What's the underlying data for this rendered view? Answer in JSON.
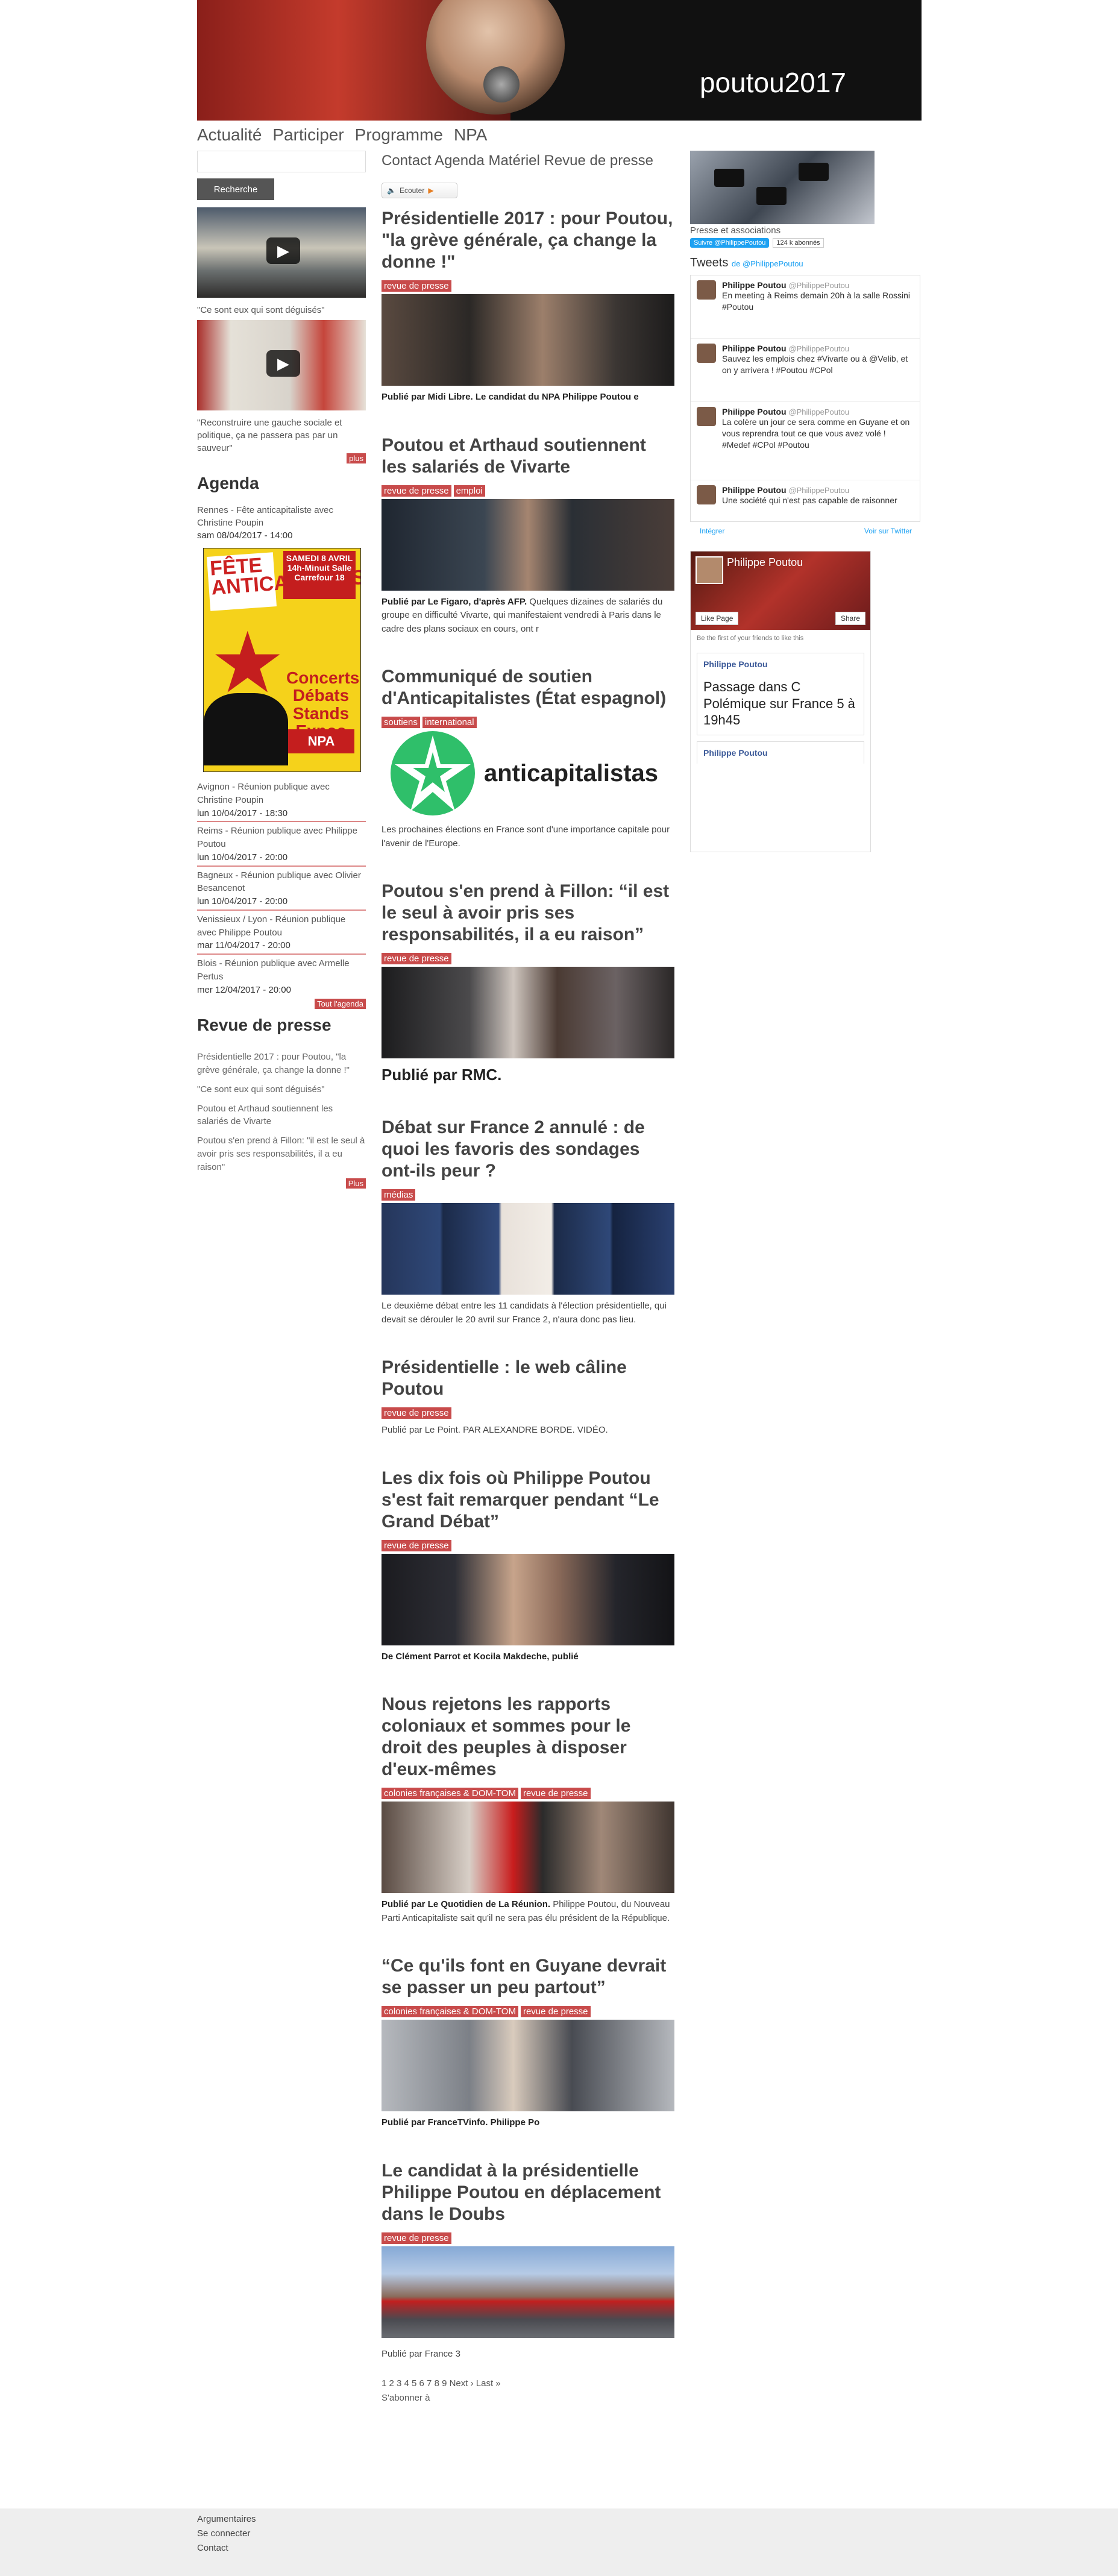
{
  "header": {
    "brand": "poutou2017"
  },
  "nav": [
    "Actualité",
    "Participer",
    "Programme",
    "NPA"
  ],
  "search": {
    "button": "Recherche"
  },
  "videos": [
    {
      "caption": "\"Ce sont eux qui sont déguisés\""
    },
    {
      "caption": "\"Reconstruire une gauche sociale et politique, ça ne passera pas par un sauveur\""
    }
  ],
  "more": "plus",
  "agenda": {
    "title": "Agenda",
    "first": {
      "label": "Rennes - Fête anticapitaliste avec Christine Poupin",
      "date": "sam 08/04/2017 - 14:00"
    },
    "poster": {
      "p1": "FÊTE ANTICAPITALISTE",
      "p2": "SAMEDI 8 AVRIL 14h-Minuit Salle Carrefour 18",
      "concert": "Concerts Débats Stands Expos",
      "npa": "NPA"
    },
    "items": [
      {
        "label": "Avignon - Réunion publique avec Christine Poupin",
        "date": "lun 10/04/2017 - 18:30"
      },
      {
        "label": "Reims - Réunion publique avec Philippe Poutou",
        "date": "lun 10/04/2017 - 20:00"
      },
      {
        "label": "Bagneux - Réunion publique avec Olivier Besancenot",
        "date": "lun 10/04/2017 - 20:00"
      },
      {
        "label": "Venissieux / Lyon - Réunion publique avec Philippe Poutou",
        "date": "mar 11/04/2017 - 20:00"
      },
      {
        "label": "Blois - Réunion publique avec Armelle Pertus",
        "date": "mer 12/04/2017 - 20:00"
      }
    ],
    "all": "Tout l'agenda"
  },
  "press": {
    "title": "Revue de presse",
    "items": [
      "Présidentielle 2017 : pour Poutou, \"la grève générale, ça change la donne !\"",
      "\"Ce sont eux qui sont déguisés\"",
      "Poutou et Arthaud soutiennent les salariés de Vivarte",
      "Poutou s'en prend à Fillon: \"il est le seul à avoir pris ses responsabilités, il a eu raison\""
    ],
    "more": "Plus"
  },
  "topmenu": "Contact Agenda Matériel Revue de presse",
  "listen": "Ecouter",
  "articles": [
    {
      "title": "Présidentielle 2017 : pour Poutou, \"la grève générale, ça change la donne !\"",
      "tags": [
        "revue de presse"
      ],
      "text_b": "Publié par Midi Libre. Le candidat du NPA Philippe Poutou e",
      "text": ""
    },
    {
      "title": "Poutou et Arthaud soutiennent les salariés de Vivarte",
      "tags": [
        "revue de presse",
        "emploi"
      ],
      "text_b": "Publié par Le Figaro, d'après AFP.",
      "text": " Quelques dizaines de salariés du groupe en difficulté Vivarte, qui manifestaient vendredi à Paris dans le cadre des plans sociaux en cours, ont r"
    },
    {
      "title": "Communiqué de soutien d'Anticapitalistes (État espagnol)",
      "tags": [
        "soutiens",
        "international"
      ],
      "logo": "anticapitalistas",
      "text_b": "",
      "text": "Les prochaines élections en France sont d'une importance capitale pour l'avenir de l'Europe."
    },
    {
      "title": "Poutou s'en prend à Fillon: “il est le seul à avoir pris ses responsabilités, il a eu raison”",
      "tags": [
        "revue de presse"
      ],
      "text_b": "Publié par RMC.",
      "text": ""
    },
    {
      "title": "Débat sur France 2 annulé : de quoi les favoris des sondages ont-ils peur ?",
      "tags": [
        "médias"
      ],
      "text_b": "",
      "text": "Le deuxième débat entre les 11 candidats à l'élection présidentielle, qui devait se dérouler le 20 avril sur France 2, n'aura donc pas lieu."
    },
    {
      "title": "Présidentielle : le web câline Poutou",
      "tags": [
        "revue de presse"
      ],
      "text_b": "",
      "text": "Publié par Le Point. PAR ALEXANDRE BORDE. VIDÉO."
    },
    {
      "title": "Les dix fois où Philippe Poutou s'est fait remarquer pendant “Le Grand Débat”",
      "tags": [
        "revue de presse"
      ],
      "text_b": "De Clément Parrot et Kocila Makdeche, publié",
      "text": ""
    },
    {
      "title": "Nous rejetons les rapports coloniaux et sommes pour le droit des peuples à disposer d'eux-mêmes",
      "tags": [
        "colonies françaises & DOM-TOM",
        "revue de presse"
      ],
      "text_b": "Publié par Le Quotidien de La Réunion.",
      "text": " Philippe Poutou, du Nouveau Parti Anticapitaliste sait qu'il ne sera pas élu président de la République."
    },
    {
      "title": "“Ce qu'ils font en Guyane devrait se passer un peu partout”",
      "tags": [
        "colonies françaises & DOM-TOM",
        "revue de presse"
      ],
      "text_b": "Publié par FranceTVinfo. Philippe Po",
      "text": ""
    },
    {
      "title": "Le candidat à la présidentielle Philippe Poutou en déplacement dans le Doubs",
      "tags": [
        "revue de presse"
      ],
      "text_b": "",
      "text": "Publié par France 3"
    }
  ],
  "pager": {
    "pages": "1 2 3 4 5 6 7 8 9 Next › Last »",
    "subscribe": "S'abonner à"
  },
  "right": {
    "presse_label": "Presse et associations",
    "follow": "Suivre @PhilippePoutou",
    "followers": "124 k abonnés",
    "tweets_title": "Tweets",
    "tweets_by": "de @PhilippePoutou",
    "tweets": [
      {
        "name": "Philippe Poutou",
        "handle": "@PhilippePoutou",
        "text": "En meeting à Reims demain 20h à la salle Rossini #Poutou"
      },
      {
        "name": "Philippe Poutou",
        "handle": "@PhilippePoutou",
        "text": "Sauvez les emplois chez #Vivarte ou à @Velib, et on y arrivera ! #Poutou #CPol"
      },
      {
        "name": "Philippe Poutou",
        "handle": "@PhilippePoutou",
        "text": "La colère un jour ce sera comme en Guyane et on vous reprendra tout ce que vous avez volé ! #Medef #CPol #Poutou"
      },
      {
        "name": "Philippe Poutou",
        "handle": "@PhilippePoutou",
        "text": "Une société qui n'est pas capable de raisonner"
      }
    ],
    "tw_embed": "Intégrer",
    "tw_view": "Voir sur Twitter",
    "fb": {
      "name": "Philippe Poutou",
      "like": "Like Page",
      "share": "Share",
      "friends": "Be the first of your friends to like this",
      "post_name": "Philippe Poutou",
      "post_text": "Passage dans C Polémique sur France 5 à 19h45",
      "post_name2": "Philippe Poutou"
    }
  },
  "footer": {
    "links": [
      "Argumentaires",
      "Se connecter",
      "Contact"
    ]
  }
}
